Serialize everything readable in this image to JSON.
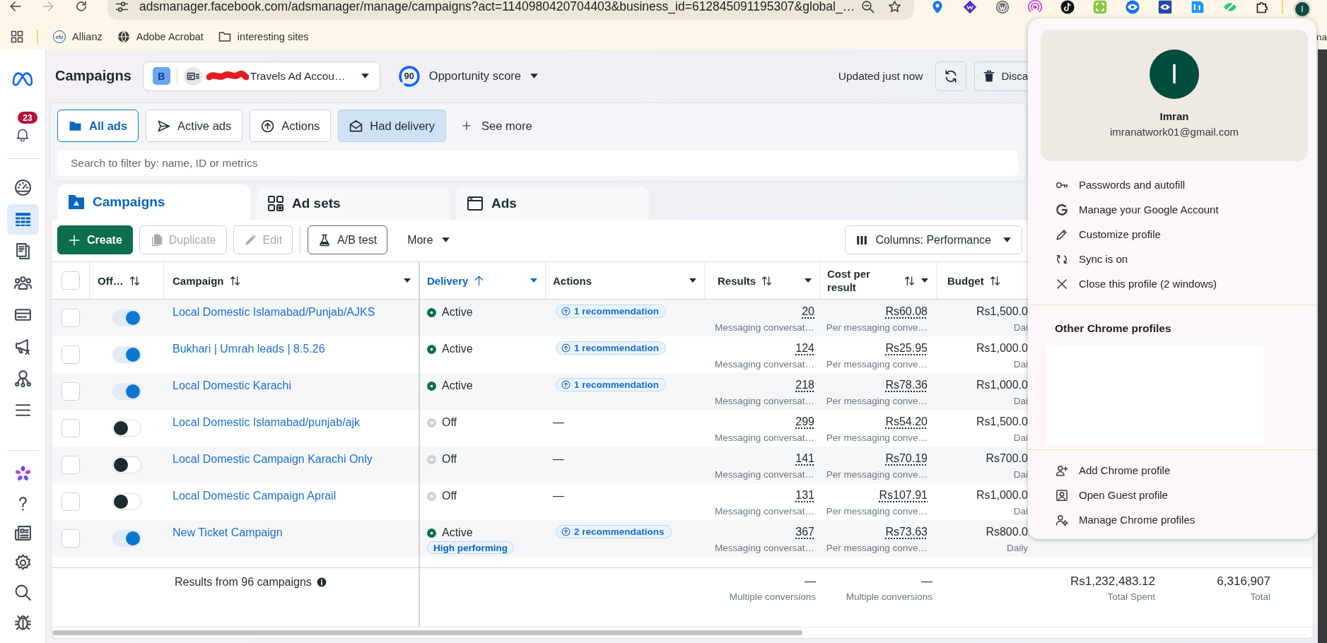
{
  "browser": {
    "url": "adsmanager.facebook.com/adsmanager/manage/campaigns?act=1140980420704403&business_id=612845091195307&global_…",
    "can_go_forward": false,
    "profile_initial": "I",
    "bookmarks": [
      {
        "label": "Allianz",
        "kind": "logo",
        "logo_text": "efu"
      },
      {
        "label": "Adobe Acrobat",
        "kind": "globe"
      },
      {
        "label": "interesting sites",
        "kind": "folder"
      }
    ],
    "bookmark_overflow": "na"
  },
  "sidebar": {
    "notifications": "23",
    "items": [
      {
        "kind": "gauge",
        "selected": false
      },
      {
        "kind": "table",
        "selected": true
      },
      {
        "kind": "pages",
        "selected": false
      },
      {
        "kind": "people",
        "selected": false
      },
      {
        "kind": "card",
        "selected": false
      },
      {
        "kind": "megaphone",
        "selected": false
      },
      {
        "kind": "network",
        "selected": false
      },
      {
        "kind": "menu",
        "selected": false
      }
    ],
    "bottom_items": [
      {
        "kind": "ai",
        "selected": false
      },
      {
        "kind": "help",
        "selected": false
      },
      {
        "kind": "news",
        "selected": false
      },
      {
        "kind": "settings",
        "selected": false
      },
      {
        "kind": "search",
        "selected": false
      },
      {
        "kind": "bug",
        "selected": false
      }
    ]
  },
  "header": {
    "title": "Campaigns",
    "account": {
      "badge": "B",
      "name": "Travels Ad Accou…"
    },
    "score": {
      "value": "90",
      "label": "Opportunity score"
    },
    "updated": "Updated just now",
    "discard": "Disca"
  },
  "filters": {
    "items": [
      {
        "label": "All ads",
        "kind": "folder",
        "selected": true,
        "applied": false
      },
      {
        "label": "Active ads",
        "kind": "send",
        "selected": false,
        "applied": false
      },
      {
        "label": "Actions",
        "kind": "up-circle",
        "selected": false,
        "applied": false
      },
      {
        "label": "Had delivery",
        "kind": "envelope",
        "selected": false,
        "applied": true
      }
    ],
    "see_more": "See more"
  },
  "search": {
    "placeholder": "Search to filter by: name, ID or metrics"
  },
  "tabs": [
    {
      "label": "Campaigns",
      "kind": "campaigns",
      "selected": true
    },
    {
      "label": "Ad sets",
      "kind": "adsets",
      "selected": false
    },
    {
      "label": "Ads",
      "kind": "ads",
      "selected": false
    }
  ],
  "toolbar": {
    "buttons": [
      {
        "label": "Create",
        "kind": "create",
        "disabled": false
      },
      {
        "label": "Duplicate",
        "kind": "duplicate",
        "disabled": true
      },
      {
        "label": "Edit",
        "kind": "edit",
        "disabled": true
      },
      {
        "label": "A/B test",
        "kind": "abtest",
        "disabled": false
      }
    ],
    "more": "More",
    "columns": "Columns: Performance"
  },
  "table": {
    "all_checked": false,
    "columns": [
      {
        "label": "Off…",
        "sortable": true,
        "sorted": false,
        "menu": false
      },
      {
        "label": "Campaign",
        "sortable": true,
        "sorted": false,
        "menu": true
      },
      {
        "label": "Delivery",
        "sortable": true,
        "sorted": true,
        "menu": true
      },
      {
        "label": "Actions",
        "sortable": false,
        "sorted": false,
        "menu": true
      },
      {
        "label": "Results",
        "sortable": true,
        "sorted": false,
        "menu": true
      },
      {
        "label": "Cost per result",
        "sortable": true,
        "sorted": false,
        "menu": true
      },
      {
        "label": "Budget",
        "sortable": true,
        "sorted": false,
        "menu": false
      }
    ],
    "rows": [
      {
        "checked": false,
        "on": true,
        "campaign": "Local Domestic Islamabad/Punjab/AJKS",
        "delivery": {
          "active": true,
          "label": "Active"
        },
        "actions": {
          "kind": "recommendation",
          "label": "1 recommendation"
        },
        "results": "20",
        "results_note": "Messaging conversat…",
        "cost": "Rs60.08",
        "cost_note": "Per messaging conve…",
        "budget": "Rs1,500.0",
        "budget_note": "Dai"
      },
      {
        "checked": false,
        "on": true,
        "campaign": "Bukhari | Umrah leads | 8.5.26",
        "delivery": {
          "active": true,
          "label": "Active"
        },
        "actions": {
          "kind": "recommendation",
          "label": "1 recommendation"
        },
        "results": "124",
        "results_note": "Messaging conversat…",
        "cost": "Rs25.95",
        "cost_note": "Per messaging conve…",
        "budget": "Rs1,000.0",
        "budget_note": "Dai"
      },
      {
        "checked": false,
        "on": true,
        "campaign": "Local Domestic Karachi",
        "delivery": {
          "active": true,
          "label": "Active"
        },
        "actions": {
          "kind": "recommendation",
          "label": "1 recommendation"
        },
        "results": "218",
        "results_note": "Messaging conversat…",
        "cost": "Rs78.36",
        "cost_note": "Per messaging conve…",
        "budget": "Rs1,000.0",
        "budget_note": "Dai"
      },
      {
        "checked": false,
        "on": false,
        "campaign": "Local Domestic Islamabad/punjab/ajk",
        "delivery": {
          "active": false,
          "label": "Off"
        },
        "actions": {
          "kind": "none",
          "label": "—"
        },
        "results": "299",
        "results_note": "Messaging conversat…",
        "cost": "Rs54.20",
        "cost_note": "Per messaging conve…",
        "budget": "Rs1,500.0",
        "budget_note": "Dai"
      },
      {
        "checked": false,
        "on": false,
        "campaign": "Local Domestic Campaign Karachi Only",
        "delivery": {
          "active": false,
          "label": "Off"
        },
        "actions": {
          "kind": "none",
          "label": "—"
        },
        "results": "141",
        "results_note": "Messaging conversat…",
        "cost": "Rs70.19",
        "cost_note": "Per messaging conve…",
        "budget": "Rs700.0",
        "budget_note": "Dai"
      },
      {
        "checked": false,
        "on": false,
        "campaign": "Local Domestic Campaign Aprail",
        "delivery": {
          "active": false,
          "label": "Off"
        },
        "actions": {
          "kind": "none",
          "label": "—"
        },
        "results": "131",
        "results_note": "Messaging conversat…",
        "cost": "Rs107.91",
        "cost_note": "Per messaging conve…",
        "budget": "Rs1,000.0",
        "budget_note": "Dai"
      },
      {
        "checked": false,
        "on": true,
        "campaign": "New Ticket Campaign",
        "delivery": {
          "active": true,
          "label": "Active",
          "tag": "High performing"
        },
        "actions": {
          "kind": "recommendation",
          "label": "2 recommendations"
        },
        "results": "367",
        "results_note": "Messaging conversat…",
        "cost": "Rs73.63",
        "cost_note": "Per messaging conve…",
        "budget": "Rs800.0",
        "budget_note": "Daily"
      }
    ],
    "footer": {
      "summary": "Results from 96 campaigns",
      "results_total": {
        "value": "—",
        "label": "Multiple conversions"
      },
      "cost_total": {
        "value": "—",
        "label": "Multiple conversions"
      },
      "spent_total": {
        "value": "Rs1,232,483.12",
        "label": "Total Spent"
      },
      "grand_total": {
        "value": "6,316,907",
        "label": "Total"
      }
    }
  },
  "profile_menu": {
    "initial": "I",
    "name": "Imran",
    "email": "imranatwork01@gmail.com",
    "items": [
      {
        "label": "Passwords and autofill",
        "kind": "key"
      },
      {
        "label": "Manage your Google Account",
        "kind": "google"
      },
      {
        "label": "Customize profile",
        "kind": "pencil"
      },
      {
        "label": "Sync is on",
        "kind": "sync"
      },
      {
        "label": "Close this profile (2 windows)",
        "kind": "close"
      }
    ],
    "other_heading": "Other Chrome profiles",
    "profile_items": [
      {
        "label": "Add Chrome profile",
        "kind": "add"
      },
      {
        "label": "Open Guest profile",
        "kind": "guest"
      },
      {
        "label": "Manage Chrome profiles",
        "kind": "manage"
      }
    ]
  }
}
